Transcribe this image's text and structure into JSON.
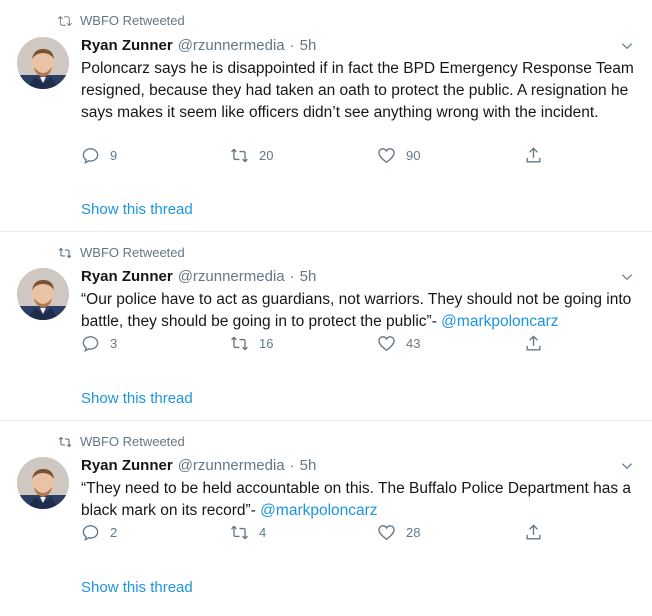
{
  "tweets": [
    {
      "retweeted_by": "WBFO Retweeted",
      "name": "Ryan Zunner",
      "handle": "@rzunnermedia",
      "separator": "·",
      "time": "5h",
      "text": "Poloncarz says he is disappointed if in fact the BPD Emergency Response Team resigned, because they had taken an oath to protect the public. A resignation he says makes it seem like officers didn’t see anything wrong with the incident.",
      "mention": "",
      "replies": "9",
      "retweets": "20",
      "likes": "90",
      "show_thread": "Show this thread"
    },
    {
      "retweeted_by": "WBFO Retweeted",
      "name": "Ryan Zunner",
      "handle": "@rzunnermedia",
      "separator": "·",
      "time": "5h",
      "text": "“Our police have to act as guardians, not warriors. They should not be going into battle, they should be going in to protect the public”- ",
      "mention": "@markpoloncarz",
      "replies": "3",
      "retweets": "16",
      "likes": "43",
      "show_thread": "Show this thread"
    },
    {
      "retweeted_by": "WBFO Retweeted",
      "name": "Ryan Zunner",
      "handle": "@rzunnermedia",
      "separator": "·",
      "time": "5h",
      "text": "“They need to be held accountable on this. The Buffalo Police Department has a black mark on its record”- ",
      "mention": "@markpoloncarz",
      "replies": "2",
      "retweets": "4",
      "likes": "28",
      "show_thread": "Show this thread"
    }
  ],
  "colors": {
    "accent": "#1b95e0",
    "muted": "#657786",
    "text": "#14171a",
    "divider": "#e6ecf0"
  },
  "icons": [
    "retweet-icon",
    "chevron-down-icon",
    "reply-icon",
    "like-icon",
    "share-icon"
  ]
}
